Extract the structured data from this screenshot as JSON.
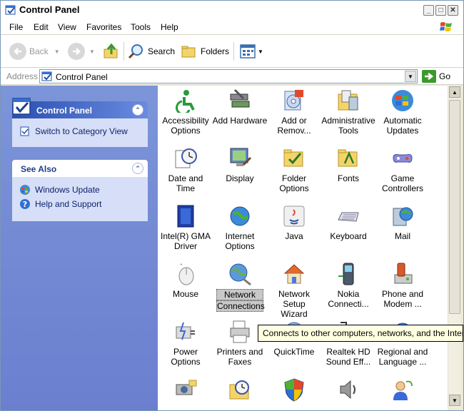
{
  "window": {
    "title": "Control Panel"
  },
  "menu": {
    "file": "File",
    "edit": "Edit",
    "view": "View",
    "favorites": "Favorites",
    "tools": "Tools",
    "help": "Help"
  },
  "toolbar": {
    "back": "Back",
    "search": "Search",
    "folders": "Folders"
  },
  "address": {
    "label": "Address",
    "value": "Control Panel",
    "go": "Go"
  },
  "taskpane": {
    "control_panel": {
      "title": "Control Panel",
      "link": "Switch to Category View"
    },
    "see_also": {
      "title": "See Also",
      "links": [
        "Windows Update",
        "Help and Support"
      ]
    }
  },
  "items": [
    {
      "l1": "Accessibility",
      "l2": "Options"
    },
    {
      "l1": "Add Hardware",
      "l2": ""
    },
    {
      "l1": "Add or",
      "l2": "Remov..."
    },
    {
      "l1": "Administrative",
      "l2": "Tools"
    },
    {
      "l1": "Automatic",
      "l2": "Updates"
    },
    {
      "l1": "Date and Time",
      "l2": ""
    },
    {
      "l1": "Display",
      "l2": ""
    },
    {
      "l1": "Folder Options",
      "l2": ""
    },
    {
      "l1": "Fonts",
      "l2": ""
    },
    {
      "l1": "Game",
      "l2": "Controllers"
    },
    {
      "l1": "Intel(R) GMA",
      "l2": "Driver"
    },
    {
      "l1": "Internet",
      "l2": "Options"
    },
    {
      "l1": "Java",
      "l2": ""
    },
    {
      "l1": "Keyboard",
      "l2": ""
    },
    {
      "l1": "Mail",
      "l2": ""
    },
    {
      "l1": "Mouse",
      "l2": ""
    },
    {
      "l1": "Network",
      "l2": "Connections"
    },
    {
      "l1": "Network Setup",
      "l2": "Wizard"
    },
    {
      "l1": "Nokia",
      "l2": "Connecti..."
    },
    {
      "l1": "Phone and",
      "l2": "Modem ..."
    },
    {
      "l1": "Power Options",
      "l2": ""
    },
    {
      "l1": "Printers and",
      "l2": "Faxes"
    },
    {
      "l1": "QuickTime",
      "l2": ""
    },
    {
      "l1": "Realtek HD",
      "l2": "Sound Eff..."
    },
    {
      "l1": "Regional and",
      "l2": "Language ..."
    }
  ],
  "tooltip": "Connects to other computers, networks, and the Internet"
}
